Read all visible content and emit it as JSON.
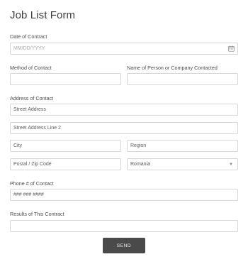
{
  "form": {
    "title": "Job List Form",
    "date": {
      "label": "Date of Contract",
      "placeholder": "MM/DD/YYYY",
      "icon": "calendar-icon"
    },
    "method": {
      "label": "Method of Contact",
      "value": ""
    },
    "person": {
      "label": "Name of Person or Company Contacted",
      "value": ""
    },
    "address": {
      "label": "Address of Contact",
      "street": "Street Address",
      "street2": "Street Address Line 2",
      "city": "City",
      "region": "Region",
      "postal": "Postal / Zip Code",
      "country": "Romania"
    },
    "phone": {
      "label": "Phone # of Contact",
      "placeholder": "### ### ####"
    },
    "results": {
      "label": "Results of This Contract",
      "value": ""
    },
    "submit_label": "SEND"
  }
}
